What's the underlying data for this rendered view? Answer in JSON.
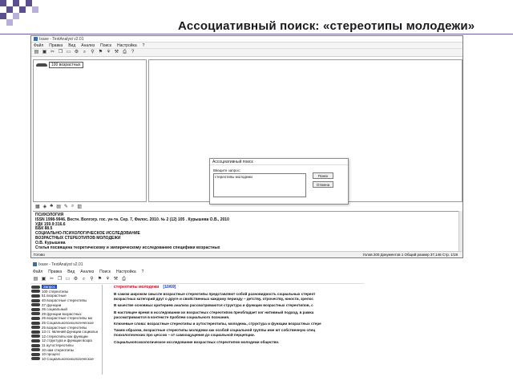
{
  "slide": {
    "title": "Ассоциативный поиск:  «стереотипы молодежи»",
    "deco_color_dark": "#5c4f8f",
    "deco_color_light": "#b8b0d8"
  },
  "window1": {
    "title": "Ixaxe - TextAnalyst v2.01",
    "menu": [
      "Файл",
      "Правка",
      "Вид",
      "Анализ",
      "Поиск",
      "Настройка",
      "?"
    ],
    "tree": [
      {
        "label": "100 возрастных"
      }
    ],
    "dialog": {
      "title": "Ассоциативный поиск",
      "label": "Введите запрос:",
      "query": "стереотипы молодежи",
      "search_button": "Поиск",
      "cancel_button": "Отмена"
    },
    "bottom_text": [
      "ПСИХОЛОГИЯ",
      "ISSN 1998-9946. Вестн. Волгогр. гос. ун-та. Сер. 7, Филос. 2010. № 2 (12) 105 . Курышева О.В., 2010",
      "УДК 159.9:316.6",
      "ББК 88.5",
      "СОЦИАЛЬНО-ПСИХОЛОГИЧЕСКОЕ ИССЛЕДОВАНИЕ",
      "ВОЗРАСТНЫХ СТЕРЕОТИПОВ МОЛОДЕЖИ",
      "О.В. Курышева",
      "Статья посвящена теоретическому и эмпирическому исследованию специфики возрастных",
      "стереотипов молодежи. В качестве основных критериев анализа рассматриваются структура и",
      "функции возрастных стереотипов, специфика возрастных аутостереотипов молодежи.",
      "Ключевые слова: возрастные стереоти-",
      "пы и аутостереотипы, молодежь, структура",
      "и функции возрастных стереотипов, возраст-",
      "ные стереотипы.",
      "Теория и методы психологии ..."
    ],
    "status_left": "Готово",
    "status_right": "Узлов 200  Документов 1  Общий размер 37,146  Стр. 1/19"
  },
  "window2": {
    "title": "Ixaxe - TextAnalyst v2.01",
    "menu": [
      "Файл",
      "Правка",
      "Вид",
      "Анализ",
      "Поиск",
      "Настройка",
      "?"
    ],
    "tree": [
      {
        "label": "Запрос",
        "selected": true
      },
      {
        "label": "100 стереотипы"
      },
      {
        "label": "51 возрастные"
      },
      {
        "label": "40 возрастные стереотипы"
      },
      {
        "label": "37 функции"
      },
      {
        "label": "36 социальный"
      },
      {
        "label": "29 функции возрастных"
      },
      {
        "label": "26 возрастные стереотипы мо"
      },
      {
        "label": "25 Социальнопсихологическое"
      },
      {
        "label": "25 возрастные стереотипы"
      },
      {
        "label": "13 ст. явлений функции социальн"
      },
      {
        "label": "12 стереотипы как функции"
      },
      {
        "label": "12 структура и функции возра"
      },
      {
        "label": "11 аутостереотипы"
      },
      {
        "label": "10 нам стереотипы"
      },
      {
        "label": "10 процесс"
      },
      {
        "label": "10 Социальнопсихологическое"
      }
    ],
    "text_head": "стереотипы молодежи",
    "text_count": "[10/69]",
    "lines": [
      "В самом широком смысле возрастные стереотипы представляют собой разновидность социальных стереот",
      "возрастных  категорий друг о друге и свойственных каждому периоду – детству, отрочеству, юности, зрелоc",
      "В качестве основных критериев анализа рассматриваются структура и  функции возрастных стереотипов, с",
      "В настоящее время в исследовании  их возрастных стереотипов преобладает ког  нитивный подход, в рамка",
      "рассматриваются в контексте  проблем социального познания.",
      "Ключевые слова: возрастные стереотипы и аутостереотипы, молодежь, структура   и функции возрастных стере",
      "Таким образом, возрастные стереотипы  молодежи как особой социальной группы име  ют собственную спец",
      "психологических  про  цессов – от самоощущения до социальной  перцепции.",
      "Социальнопсихологическое исследование возрастных стереотипов молодежи  общество."
    ]
  }
}
